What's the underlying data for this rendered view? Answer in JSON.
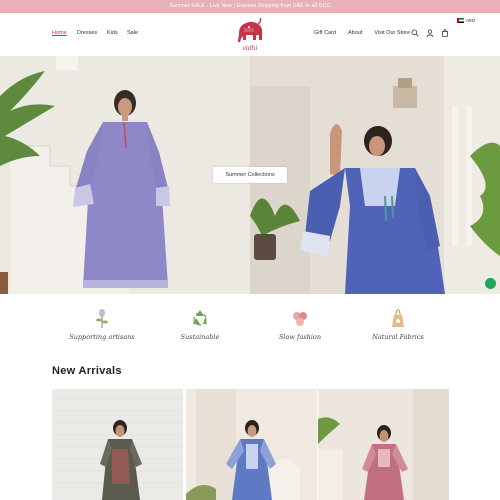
{
  "announcement": {
    "text": "Summer SALE - Live Now | Express Shipping from UAE to all GCC"
  },
  "header": {
    "nav_left": [
      {
        "label": "Home"
      },
      {
        "label": "Dresses"
      },
      {
        "label": "Kids"
      },
      {
        "label": "Sale"
      }
    ],
    "brand": "vidhi",
    "nav_right": [
      {
        "label": "Gift Card"
      },
      {
        "label": "About"
      },
      {
        "label": "Visit Our Store"
      }
    ],
    "icons": [
      "search-icon",
      "account-icon",
      "cart-icon"
    ],
    "language": "AED"
  },
  "hero": {
    "button_label": "Summer Collections"
  },
  "values": [
    {
      "label": "Supporting artisans",
      "icon": "flower-icon"
    },
    {
      "label": "Sustainable",
      "icon": "recycle-icon"
    },
    {
      "label": "Slow fashion",
      "icon": "yarn-icon"
    },
    {
      "label": "Natural Fabrics",
      "icon": "cotton-bag-icon"
    }
  ],
  "new_arrivals": {
    "title": "New Arrivals"
  },
  "colors": {
    "announcement_bg": "#e6b2b8",
    "accent": "#c6344a"
  }
}
